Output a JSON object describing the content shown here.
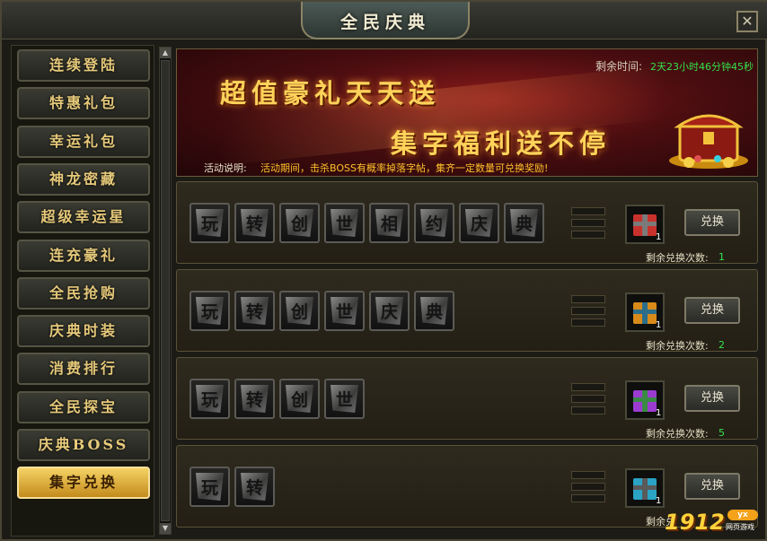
{
  "window": {
    "title": "全民庆典",
    "close_symbol": "✕"
  },
  "sidebar": {
    "items": [
      {
        "label": "连续登陆",
        "active": false
      },
      {
        "label": "特惠礼包",
        "active": false
      },
      {
        "label": "幸运礼包",
        "active": false
      },
      {
        "label": "神龙密藏",
        "active": false
      },
      {
        "label": "超级幸运星",
        "active": false
      },
      {
        "label": "连充豪礼",
        "active": false
      },
      {
        "label": "全民抢购",
        "active": false
      },
      {
        "label": "庆典时装",
        "active": false
      },
      {
        "label": "消费排行",
        "active": false
      },
      {
        "label": "全民探宝",
        "active": false
      },
      {
        "label": "庆典BOSS",
        "active": false
      },
      {
        "label": "集字兑换",
        "active": true
      }
    ]
  },
  "banner": {
    "headline1": "超值豪礼天天送",
    "headline2": "集字福利送不停",
    "time_label": "剩余时间:",
    "time_value": "2天23小时46分钟45秒",
    "desc_label": "活动说明:",
    "desc_text": "活动期间，击杀BOSS有概率掉落字帖，集齐一定数量可兑换奖励!"
  },
  "rows": [
    {
      "chars": [
        "玩",
        "转",
        "创",
        "世",
        "相",
        "约",
        "庆",
        "典"
      ],
      "gift_color": "#c8322c",
      "ribbon_color": "#7a7a7a",
      "gift_count": "1",
      "button": "兑换",
      "remain_label": "剩余兑换次数:",
      "remain_value": "1"
    },
    {
      "chars": [
        "玩",
        "转",
        "创",
        "世",
        "庆",
        "典"
      ],
      "gift_color": "#d88a1a",
      "ribbon_color": "#2c6e8a",
      "gift_count": "1",
      "button": "兑换",
      "remain_label": "剩余兑换次数:",
      "remain_value": "2"
    },
    {
      "chars": [
        "玩",
        "转",
        "创",
        "世"
      ],
      "gift_color": "#9b3bd0",
      "ribbon_color": "#3a8a44",
      "gift_count": "1",
      "button": "兑换",
      "remain_label": "剩余兑换次数:",
      "remain_value": "5"
    },
    {
      "chars": [
        "玩",
        "转"
      ],
      "gift_color": "#2aa3c4",
      "ribbon_color": "#5a5a5a",
      "gift_count": "1",
      "button": "兑换",
      "remain_label": "剩余兑",
      "remain_value": ""
    }
  ],
  "watermark": {
    "text": "1912",
    "badge": "yx",
    "sub": "网页游戏"
  }
}
